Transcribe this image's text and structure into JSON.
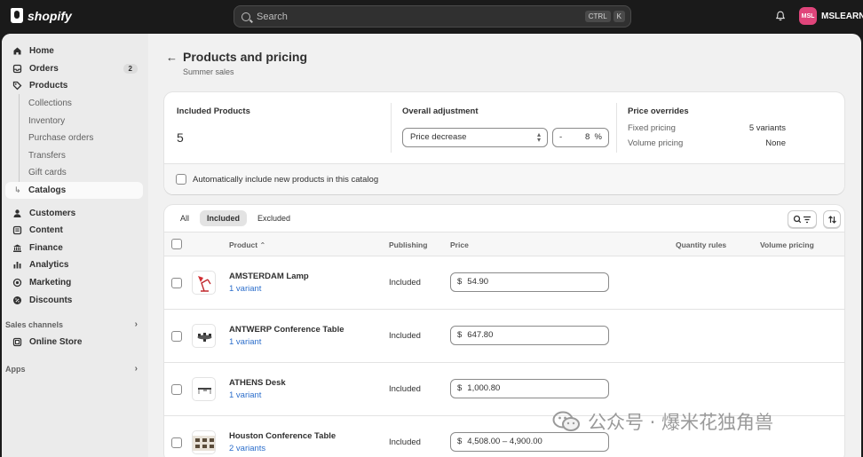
{
  "topbar": {
    "logo_text": "shopify",
    "search_placeholder": "Search",
    "shortcut_keys": [
      "CTRL",
      "K"
    ],
    "avatar_initials": "MSL",
    "store_name": "MSLEARN"
  },
  "sidebar": {
    "items": [
      {
        "label": "Home",
        "icon": "home-icon"
      },
      {
        "label": "Orders",
        "icon": "inbox-icon",
        "badge": "2"
      },
      {
        "label": "Products",
        "icon": "tag-icon"
      }
    ],
    "product_subitems": [
      "Collections",
      "Inventory",
      "Purchase orders",
      "Transfers",
      "Gift cards",
      "Catalogs"
    ],
    "active_subitem": "Catalogs",
    "more_items": [
      {
        "label": "Customers",
        "icon": "person-icon"
      },
      {
        "label": "Content",
        "icon": "content-icon"
      },
      {
        "label": "Finance",
        "icon": "bank-icon"
      },
      {
        "label": "Analytics",
        "icon": "bar-chart-icon"
      },
      {
        "label": "Marketing",
        "icon": "target-icon"
      },
      {
        "label": "Discounts",
        "icon": "discount-icon"
      }
    ],
    "sales_channels_label": "Sales channels",
    "online_store_label": "Online Store",
    "apps_label": "Apps"
  },
  "page": {
    "title": "Products and pricing",
    "subtitle": "Summer sales"
  },
  "summary": {
    "included_products_label": "Included Products",
    "included_products_value": "5",
    "overall_adjustment_label": "Overall adjustment",
    "adjustment_select_value": "Price decrease",
    "adjustment_sign": "-",
    "adjustment_percent": "8",
    "percent_symbol": "%",
    "price_overrides_label": "Price overrides",
    "fixed_pricing_label": "Fixed pricing",
    "fixed_pricing_value": "5 variants",
    "volume_pricing_label": "Volume pricing",
    "volume_pricing_value": "None",
    "auto_include_label": "Automatically include new products in this catalog"
  },
  "table": {
    "tabs": [
      "All",
      "Included",
      "Excluded"
    ],
    "selected_tab": "Included",
    "columns": {
      "product": "Product",
      "publishing": "Publishing",
      "price": "Price",
      "quantity_rules": "Quantity rules",
      "volume_pricing": "Volume pricing"
    },
    "rows": [
      {
        "name": "AMSTERDAM Lamp",
        "variants": "1 variant",
        "publishing": "Included",
        "currency": "$",
        "price": "54.90"
      },
      {
        "name": "ANTWERP Conference Table",
        "variants": "1 variant",
        "publishing": "Included",
        "currency": "$",
        "price": "647.80"
      },
      {
        "name": "ATHENS Desk",
        "variants": "1 variant",
        "publishing": "Included",
        "currency": "$",
        "price": "1,000.80"
      },
      {
        "name": "Houston Conference Table",
        "variants": "2 variants",
        "publishing": "Included",
        "currency": "$",
        "price": "4,508.00 – 4,900.00"
      }
    ]
  },
  "watermark": {
    "text": "公众号 · 爆米花独角兽"
  }
}
